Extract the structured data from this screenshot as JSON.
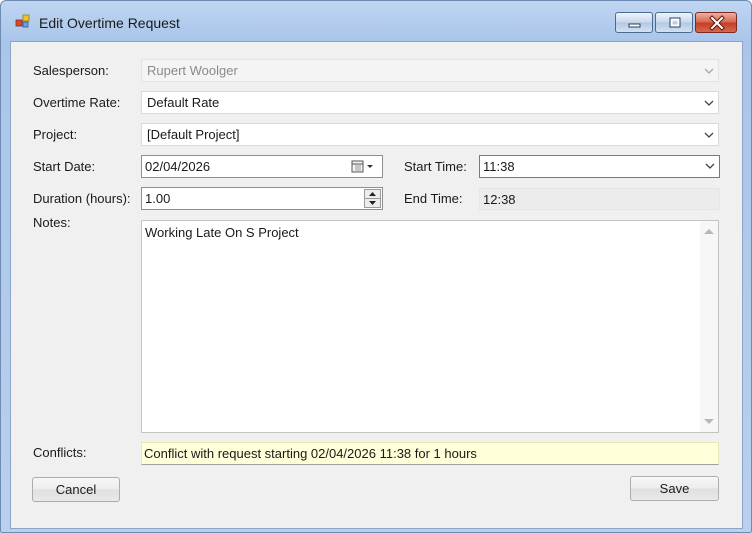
{
  "window": {
    "title": "Edit Overtime Request"
  },
  "form": {
    "salesperson": {
      "label": "Salesperson:",
      "value": "Rupert Woolger"
    },
    "overtime_rate": {
      "label": "Overtime Rate:",
      "value": "Default Rate"
    },
    "project": {
      "label": "Project:",
      "value": "[Default Project]"
    },
    "start_date": {
      "label": "Start Date:",
      "value": "02/04/2026"
    },
    "start_time": {
      "label": "Start Time:",
      "value": "11:38"
    },
    "duration": {
      "label": "Duration (hours):",
      "value": "1.00"
    },
    "end_time": {
      "label": "End Time:",
      "value": "12:38"
    },
    "notes": {
      "label": "Notes:",
      "value": "Working Late On S Project"
    },
    "conflicts": {
      "label": "Conflicts:",
      "value": "Conflict with request starting 02/04/2026 11:38 for 1 hours"
    }
  },
  "buttons": {
    "cancel": "Cancel",
    "save": "Save"
  },
  "icons": {
    "app": "app-icon",
    "minimize": "minimize-icon",
    "maximize": "maximize-icon",
    "close": "close-icon",
    "calendar": "calendar-icon",
    "dropdown": "chevron-down-icon",
    "spinner": "spinner-arrows-icon"
  }
}
